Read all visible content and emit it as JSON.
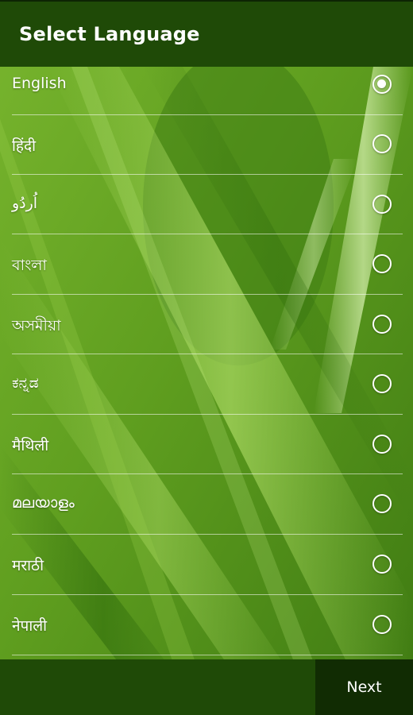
{
  "header": {
    "title": "Select Language"
  },
  "languages": [
    {
      "label": "English",
      "selected": true
    },
    {
      "label": "हिंदी",
      "selected": false
    },
    {
      "label": "اُردُو",
      "selected": false
    },
    {
      "label": "বাংলা",
      "selected": false
    },
    {
      "label": "অসমীয়া",
      "selected": false
    },
    {
      "label": "ಕನ್ನಡ",
      "selected": false
    },
    {
      "label": "मैथिली",
      "selected": false
    },
    {
      "label": "മലയാളം",
      "selected": false
    },
    {
      "label": "मराठी",
      "selected": false
    },
    {
      "label": "नेपाली",
      "selected": false
    }
  ],
  "footer": {
    "next_label": "Next"
  },
  "colors": {
    "bar": "#1f4a07",
    "next_button": "#112c03",
    "background_leaf": "#5d9a22"
  }
}
